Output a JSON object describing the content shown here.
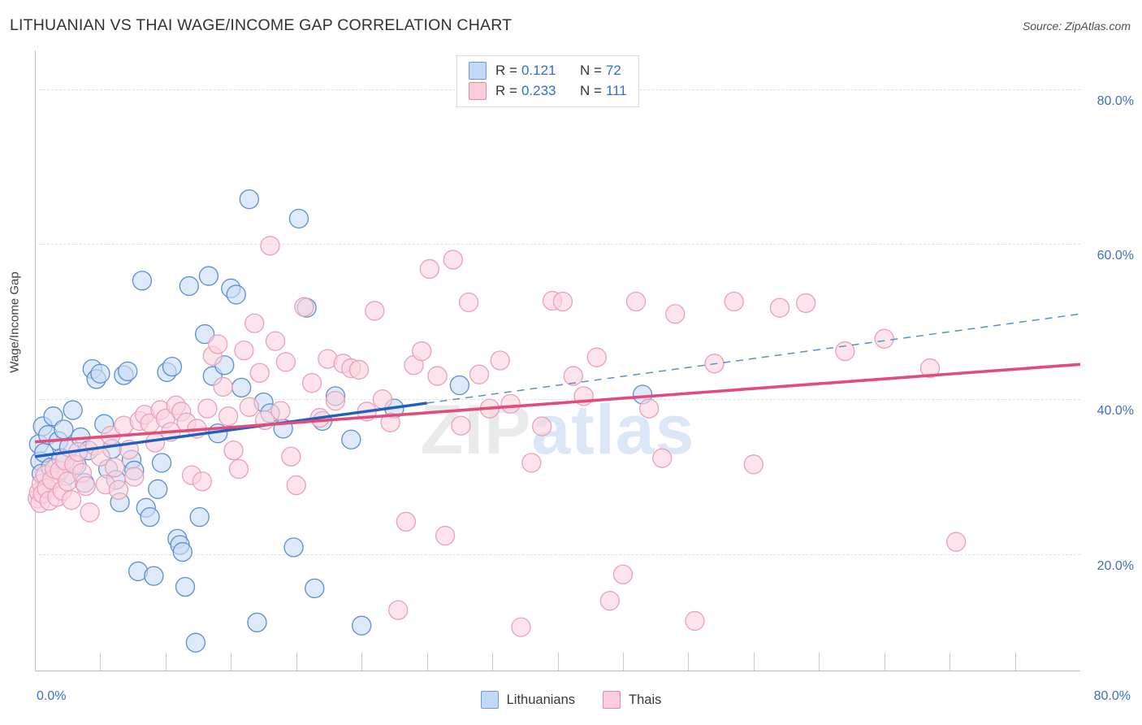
{
  "header": {
    "title": "LITHUANIAN VS THAI WAGE/INCOME GAP CORRELATION CHART",
    "source": "Source: ZipAtlas.com"
  },
  "watermark": {
    "part1": "ZIP",
    "part2": "atlas"
  },
  "stats": {
    "rows": [
      {
        "series": "Lithuanians",
        "r_label": "R =",
        "r_value": "0.121",
        "n_label": "N =",
        "n_value": "72",
        "color": "#c3d9f5"
      },
      {
        "series": "Thais",
        "r_label": "R =",
        "r_value": "0.233",
        "n_label": "N =",
        "n_value": "111",
        "color": "#fbccd9"
      }
    ]
  },
  "legend": {
    "items": [
      {
        "label": "Lithuanians",
        "color": "#c3d9f5"
      },
      {
        "label": "Thais",
        "color": "#fbccd9"
      }
    ]
  },
  "chart_data": {
    "type": "scatter",
    "title": "LITHUANIAN VS THAI WAGE/INCOME GAP CORRELATION CHART",
    "xlabel": "",
    "ylabel": "Wage/Income Gap",
    "xlim": [
      0,
      80
    ],
    "ylim": [
      5,
      85
    ],
    "grid": true,
    "legend_position": "bottom-center",
    "x_ticks": [
      0,
      80
    ],
    "x_tick_labels": [
      "0.0%",
      "80.0%"
    ],
    "y_ticks": [
      20,
      40,
      60,
      80
    ],
    "y_tick_labels": [
      "20.0%",
      "40.0%",
      "60.0%",
      "80.0%"
    ],
    "y_tick_side": "right",
    "series": [
      {
        "name": "Lithuanians",
        "r": 0.121,
        "n": 72,
        "fill": "#c9dcf6",
        "stroke": "#5b8dcf",
        "trend": {
          "x0": 0,
          "y0": 32.6,
          "x1": 80,
          "y1": 51.0,
          "solid_until_x": 30,
          "solid_color": "#1f5fc0",
          "dashed_color": "#5b8dcf"
        },
        "points": [
          [
            0.3,
            34.2
          ],
          [
            0.4,
            32.0
          ],
          [
            0.5,
            30.4
          ],
          [
            0.6,
            36.5
          ],
          [
            0.7,
            33.1
          ],
          [
            0.9,
            28.6
          ],
          [
            1.0,
            35.4
          ],
          [
            1.2,
            31.2
          ],
          [
            1.4,
            37.8
          ],
          [
            1.6,
            29.9
          ],
          [
            1.8,
            34.6
          ],
          [
            2.0,
            32.4
          ],
          [
            2.2,
            36.1
          ],
          [
            2.4,
            30.1
          ],
          [
            2.6,
            33.8
          ],
          [
            2.9,
            38.6
          ],
          [
            3.2,
            31.5
          ],
          [
            3.5,
            35.1
          ],
          [
            3.8,
            29.2
          ],
          [
            4.1,
            33.4
          ],
          [
            4.4,
            43.9
          ],
          [
            4.7,
            42.6
          ],
          [
            5.0,
            43.3
          ],
          [
            5.3,
            36.8
          ],
          [
            5.6,
            31.0
          ],
          [
            5.9,
            33.6
          ],
          [
            6.2,
            29.6
          ],
          [
            6.5,
            26.7
          ],
          [
            6.8,
            43.1
          ],
          [
            7.1,
            43.6
          ],
          [
            7.4,
            32.2
          ],
          [
            7.6,
            30.8
          ],
          [
            7.9,
            17.8
          ],
          [
            8.2,
            55.3
          ],
          [
            8.5,
            26.0
          ],
          [
            8.8,
            24.8
          ],
          [
            9.1,
            17.2
          ],
          [
            9.4,
            28.4
          ],
          [
            9.7,
            31.8
          ],
          [
            10.1,
            43.5
          ],
          [
            10.5,
            44.2
          ],
          [
            10.9,
            22.0
          ],
          [
            11.1,
            21.2
          ],
          [
            11.3,
            20.3
          ],
          [
            11.5,
            15.8
          ],
          [
            11.8,
            54.6
          ],
          [
            12.3,
            8.6
          ],
          [
            12.6,
            24.8
          ],
          [
            13.0,
            48.4
          ],
          [
            13.3,
            55.9
          ],
          [
            13.6,
            43.0
          ],
          [
            14.0,
            35.6
          ],
          [
            14.5,
            44.4
          ],
          [
            15.0,
            54.3
          ],
          [
            15.4,
            53.5
          ],
          [
            15.8,
            41.5
          ],
          [
            16.4,
            65.8
          ],
          [
            17.0,
            11.2
          ],
          [
            17.5,
            39.6
          ],
          [
            18.0,
            38.2
          ],
          [
            19.0,
            36.2
          ],
          [
            19.8,
            20.9
          ],
          [
            20.2,
            63.3
          ],
          [
            20.8,
            51.8
          ],
          [
            21.4,
            15.6
          ],
          [
            22.0,
            37.2
          ],
          [
            23.0,
            40.4
          ],
          [
            24.2,
            34.8
          ],
          [
            25.0,
            10.8
          ],
          [
            27.5,
            38.8
          ],
          [
            32.5,
            41.8
          ],
          [
            46.5,
            40.6
          ]
        ]
      },
      {
        "name": "Thais",
        "r": 0.233,
        "n": 111,
        "fill": "#fbd4de",
        "stroke": "#e8a0b8",
        "trend": {
          "x0": 0,
          "y0": 34.5,
          "x1": 80,
          "y1": 44.5,
          "solid_color": "#e34b78"
        },
        "points": [
          [
            0.2,
            27.2
          ],
          [
            0.3,
            28.0
          ],
          [
            0.4,
            26.6
          ],
          [
            0.5,
            29.1
          ],
          [
            0.6,
            27.8
          ],
          [
            0.8,
            30.2
          ],
          [
            0.9,
            28.5
          ],
          [
            1.1,
            26.9
          ],
          [
            1.3,
            29.6
          ],
          [
            1.5,
            31.0
          ],
          [
            1.7,
            27.4
          ],
          [
            1.9,
            30.8
          ],
          [
            2.1,
            28.2
          ],
          [
            2.3,
            32.1
          ],
          [
            2.5,
            29.4
          ],
          [
            2.8,
            27.0
          ],
          [
            3.0,
            31.6
          ],
          [
            3.3,
            33.2
          ],
          [
            3.6,
            30.5
          ],
          [
            3.9,
            28.8
          ],
          [
            4.2,
            25.4
          ],
          [
            4.6,
            34.0
          ],
          [
            5.0,
            32.6
          ],
          [
            5.4,
            29.0
          ],
          [
            5.8,
            35.3
          ],
          [
            6.1,
            31.2
          ],
          [
            6.4,
            28.3
          ],
          [
            6.8,
            36.6
          ],
          [
            7.2,
            33.5
          ],
          [
            7.6,
            30.0
          ],
          [
            8.0,
            37.2
          ],
          [
            8.4,
            38.0
          ],
          [
            8.8,
            36.9
          ],
          [
            9.2,
            34.4
          ],
          [
            9.6,
            38.6
          ],
          [
            10.0,
            37.5
          ],
          [
            10.4,
            35.8
          ],
          [
            10.8,
            39.2
          ],
          [
            11.2,
            38.4
          ],
          [
            11.6,
            37.0
          ],
          [
            12.0,
            30.2
          ],
          [
            12.4,
            36.2
          ],
          [
            12.8,
            29.4
          ],
          [
            13.2,
            38.8
          ],
          [
            13.6,
            45.6
          ],
          [
            14.0,
            47.1
          ],
          [
            14.4,
            41.6
          ],
          [
            14.8,
            37.8
          ],
          [
            15.2,
            33.4
          ],
          [
            15.6,
            31.0
          ],
          [
            16.0,
            46.3
          ],
          [
            16.4,
            39.0
          ],
          [
            16.8,
            49.8
          ],
          [
            17.2,
            43.4
          ],
          [
            17.6,
            37.3
          ],
          [
            18.0,
            59.8
          ],
          [
            18.4,
            47.5
          ],
          [
            18.8,
            38.5
          ],
          [
            19.2,
            44.8
          ],
          [
            19.6,
            32.6
          ],
          [
            20.0,
            28.9
          ],
          [
            20.6,
            51.9
          ],
          [
            21.2,
            42.1
          ],
          [
            21.8,
            37.6
          ],
          [
            22.4,
            45.2
          ],
          [
            23.0,
            39.8
          ],
          [
            23.6,
            44.6
          ],
          [
            24.2,
            44.0
          ],
          [
            24.8,
            43.8
          ],
          [
            25.4,
            38.4
          ],
          [
            26.0,
            51.4
          ],
          [
            26.6,
            40.0
          ],
          [
            27.2,
            37.0
          ],
          [
            27.8,
            12.8
          ],
          [
            28.4,
            24.2
          ],
          [
            29.0,
            44.4
          ],
          [
            29.6,
            46.2
          ],
          [
            30.2,
            56.8
          ],
          [
            30.8,
            43.0
          ],
          [
            31.4,
            22.4
          ],
          [
            32.0,
            58.0
          ],
          [
            32.6,
            36.6
          ],
          [
            33.2,
            52.5
          ],
          [
            34.0,
            43.2
          ],
          [
            34.8,
            38.8
          ],
          [
            35.6,
            45.0
          ],
          [
            36.4,
            39.4
          ],
          [
            37.2,
            10.6
          ],
          [
            38.0,
            31.8
          ],
          [
            38.8,
            36.5
          ],
          [
            39.6,
            52.7
          ],
          [
            40.4,
            52.6
          ],
          [
            41.2,
            43.0
          ],
          [
            42.0,
            40.4
          ],
          [
            43.0,
            45.4
          ],
          [
            44.0,
            14.0
          ],
          [
            45.0,
            17.4
          ],
          [
            46.0,
            52.6
          ],
          [
            47.0,
            38.8
          ],
          [
            48.0,
            32.4
          ],
          [
            49.0,
            51.0
          ],
          [
            50.5,
            11.4
          ],
          [
            52.0,
            44.6
          ],
          [
            53.5,
            52.6
          ],
          [
            55.0,
            31.6
          ],
          [
            57.0,
            51.8
          ],
          [
            59.0,
            52.4
          ],
          [
            62.0,
            46.2
          ],
          [
            65.0,
            47.8
          ],
          [
            68.5,
            44.0
          ],
          [
            70.5,
            21.6
          ]
        ]
      }
    ]
  }
}
